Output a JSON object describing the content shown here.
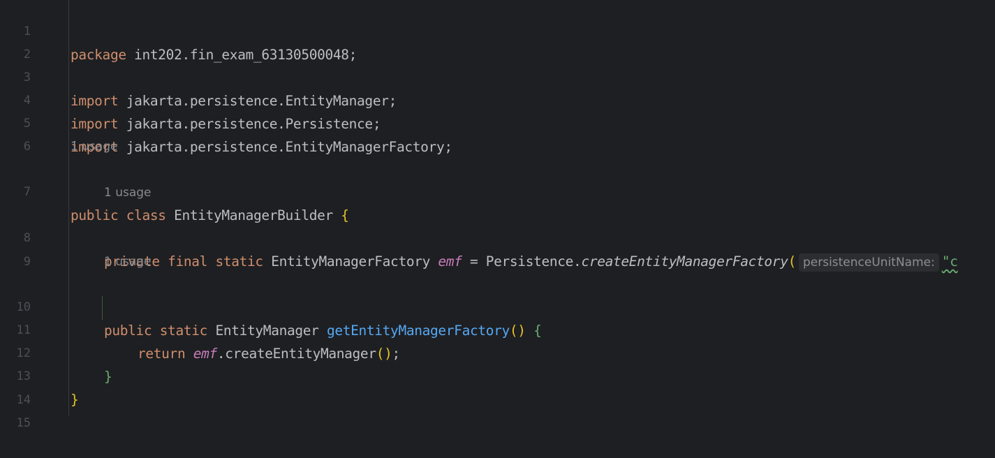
{
  "editor": {
    "lines": [
      {
        "num": "1",
        "tokens": [
          "package",
          " int202.fin_exam_63130500048;"
        ]
      },
      {
        "num": "2"
      },
      {
        "num": "3",
        "tokens": [
          "import",
          " jakarta.persistence.EntityManager;"
        ]
      },
      {
        "num": "4",
        "tokens": [
          "import",
          " jakarta.persistence.Persistence;"
        ]
      },
      {
        "num": "5",
        "tokens": [
          "import",
          " jakarta.persistence.EntityManagerFactory;"
        ]
      },
      {
        "num": "6"
      },
      {
        "num": "7",
        "lens": "1 usage",
        "tokens": [
          "public",
          " ",
          "class",
          " EntityManagerBuilder ",
          "{"
        ]
      },
      {
        "num": "8",
        "lens": "1 usage",
        "tokens": [
          "private",
          " ",
          "final",
          " ",
          "static",
          " EntityManagerFactory ",
          "emf",
          " = Persistence.",
          "createEntityManagerFactory",
          "(",
          "persistenceUnitName:",
          "\"c"
        ]
      },
      {
        "num": "9"
      },
      {
        "num": "10",
        "lens": "1 usage",
        "tokens": [
          "public",
          " ",
          "static",
          " EntityManager ",
          "getEntityManagerFactory",
          "()",
          " ",
          "{"
        ]
      },
      {
        "num": "11",
        "tokens": [
          "return",
          " ",
          "emf",
          ".createEntityManager",
          "()",
          ";"
        ]
      },
      {
        "num": "12",
        "tokens": [
          "}"
        ]
      },
      {
        "num": "13",
        "tokens": [
          "}"
        ]
      },
      {
        "num": "14"
      },
      {
        "num": "15"
      }
    ]
  },
  "colors": {
    "background": "#1e1f22",
    "keyword": "#cf8e6d",
    "text": "#bcbec4",
    "field": "#c77dbb",
    "method": "#56a8f5",
    "string": "#6aab73",
    "bracket_level1": "#e6c229",
    "bracket_level2": "#6aab73",
    "line_number": "#4b5059",
    "code_lens": "#868a91"
  }
}
